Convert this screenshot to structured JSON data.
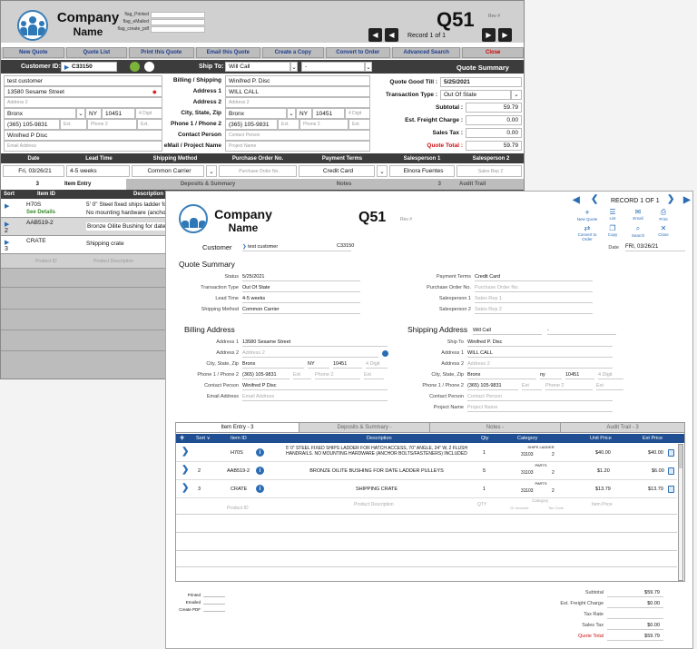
{
  "back": {
    "company": {
      "line1": "Company",
      "line2": "Name"
    },
    "flags": [
      "flag_Printed",
      "flag_eMailed",
      "flag_create_pdf"
    ],
    "quote_no": "Q51",
    "rev": "Rev #",
    "record": "Record  1  of  1",
    "toolbar": [
      "New Quote",
      "Quote List",
      "Print this Quote",
      "Email this Quote",
      "Create a Copy",
      "Convert to Order",
      "Advanced Search",
      "Close"
    ],
    "customer_id_label": "Customer ID:",
    "customer_id": "C33150",
    "ship_to_label": "Ship To:",
    "ship_to": "Will Call",
    "ship_to2": "-",
    "quote_summary_title": "Quote Summary",
    "cust": {
      "name": "test customer",
      "address1": "13580 Sesame Street",
      "address2_ph": "Address 2",
      "city": "Bronx",
      "state": "NY",
      "zip": "10451",
      "zip4_ph": "4 Digit",
      "phone": "(365) 105-9831",
      "ext_ph": "Ext.",
      "phone2_ph": "Phone 2",
      "ext2_ph": "Ext.",
      "contact": "Winifred P Disc",
      "email_ph": "Email Address"
    },
    "mid_labels": [
      "Billing / Shipping",
      "Address 1",
      "Address 2",
      "City, State, Zip",
      "Phone 1 / Phone 2",
      "Contact Person",
      "eMail / Project Name"
    ],
    "ship": {
      "name": "Winifred P. Disc",
      "address1": "WILL CALL",
      "address2_ph": "Address 2",
      "city": "Bronx",
      "state": "NY",
      "zip": "10451",
      "zip4_ph": "4 Digit",
      "phone": "(365) 105-9831",
      "ext_ph": "Ext.",
      "phone2_ph": "Phone 2",
      "ext2_ph": "Ext.",
      "contact_ph": "Contact Person",
      "project_ph": "Project Name"
    },
    "summary": {
      "good_till_label": "Quote Good Till :",
      "good_till": "5/25/2021",
      "trans_type_label": "Transaction Type :",
      "trans_type": "Out Of State",
      "subtotal_label": "Subtotal :",
      "subtotal": "59.79",
      "freight_label": "Est. Freight Charge :",
      "freight": "0.00",
      "tax_label": "Sales Tax :",
      "tax": "0.00",
      "total_label": "Quote Total :",
      "total": "59.79"
    },
    "info_headers": [
      "Date",
      "Lead Time",
      "Shipping Method",
      "Purchase Order No.",
      "Payment Terms",
      "Salesperson 1",
      "Salesperson 2"
    ],
    "info_values": {
      "date": "Fri, 03/26/21",
      "lead": "4-5 weeks",
      "ship_method": "Common Carrier",
      "po_ph": "Purchase Order No.",
      "terms": "Credit Card",
      "sp1": "Elnora Fuentes",
      "sp2_ph": "Sales Rep 2"
    },
    "tabs": [
      {
        "count": "3",
        "label": "Item Entry"
      },
      {
        "count": "",
        "label": "Deposits & Summary"
      },
      {
        "count": "",
        "label": "Notes"
      },
      {
        "count": "3",
        "label": "Audit Trail"
      }
    ],
    "list_headers": {
      "sort": "Sort",
      "item": "Item ID",
      "desc": "Description"
    },
    "items": [
      {
        "sort": "",
        "id": "H70S",
        "extra": "See Details",
        "desc": "5' 0\" Steel fixed ships ladder fo",
        "desc2": "No mounting hardware (anchor"
      },
      {
        "sort": "2",
        "id": "AAB519-2",
        "extra": "",
        "desc": "Bronze Oilite Bushing for date",
        "desc2": ""
      },
      {
        "sort": "3",
        "id": "CRATE",
        "extra": "",
        "desc": "Shipping crate",
        "desc2": ""
      }
    ],
    "new_row": {
      "product_ph": "Product ID",
      "desc_ph": "Product Description"
    }
  },
  "front": {
    "company": {
      "line1": "Company",
      "line2": "Name"
    },
    "quote_no": "Q51",
    "rev": "Rev #",
    "record": "RECORD  1  OF  1",
    "tools_row1": [
      "New Quote",
      "List",
      "Email",
      "Print"
    ],
    "tools_row2": [
      "Convert to Order",
      "Copy",
      "Search",
      "Close"
    ],
    "customer_label": "Customer",
    "customer_name": "test customer",
    "customer_id": "C33150",
    "date_label": "Date",
    "date": "FRI, 03/26/21",
    "quote_summary_title": "Quote Summary",
    "qs_left": [
      {
        "label": "Status",
        "value": "5/25/2021",
        "ph": false
      },
      {
        "label": "Transaction Type",
        "value": "Out Of State",
        "ph": false
      },
      {
        "label": "Lead Time",
        "value": "4-5 weeks",
        "ph": false
      },
      {
        "label": "Shipping Method",
        "value": "Common Carrier",
        "ph": false
      }
    ],
    "qs_right": [
      {
        "label": "Payment Terms",
        "value": "Credit Card",
        "ph": false
      },
      {
        "label": "Purchase Order No.",
        "value": "Purchase Order No.",
        "ph": true
      },
      {
        "label": "Salesperson 1",
        "value": "Sales Rep 1",
        "ph": true
      },
      {
        "label": "Salesperson 2",
        "value": "Sales Rep 2",
        "ph": true
      }
    ],
    "billing_title": "Billing Address",
    "billing": {
      "address1_label": "Address 1",
      "address1": "13580 Sesame Street",
      "address2_label": "Address 2",
      "address2_ph": "Address 2",
      "csz_label": "City, State, Zip",
      "city": "Bronx",
      "state": "NY",
      "zip": "10451",
      "zip4_ph": "4 Digit",
      "phone_label": "Phone 1 / Phone 2",
      "phone": "(365) 105-9831",
      "ext_ph": "Ext",
      "phone2_ph": "Phone 2",
      "ext2_ph": "Ext",
      "contact_label": "Contact Person",
      "contact": "Winifred P Disc",
      "email_label": "Email Address",
      "email_ph": "Email Address"
    },
    "shipping_title": "Shipping Address",
    "shipping": {
      "head": "Will Call",
      "head2": "-",
      "shipto_label": "Ship To",
      "shipto": "Winifred P. Disc",
      "address1_label": "Address 1",
      "address1": "WILL CALL",
      "address2_label": "Address 2",
      "address2_ph": "Address 2",
      "csz_label": "City, State, Zip",
      "city": "Bronx",
      "state": "ny",
      "zip": "10451",
      "zip4_ph": "4 Digit",
      "phone_label": "Phone 1 / Phone 2",
      "phone": "(365) 105-9831",
      "ext_ph": "Ext",
      "phone2_ph": "Phone 2",
      "ext2_ph": "Ext",
      "contact_label": "Contact Person",
      "contact_ph": "Contact Person",
      "project_label": "Project Name",
      "project_ph": "Project Name"
    },
    "tabs": [
      "Item Entry - 3",
      "Deposits & Summary -",
      "Notes -",
      "Audit Trail - 3"
    ],
    "grid_headers": {
      "plus": "+",
      "sort": "Sort ∨",
      "item": "Item ID",
      "desc": "Description",
      "qty": "Qty",
      "cat": "Category",
      "unit": "Unit Price",
      "ext": "Ext Price"
    },
    "rows": [
      {
        "sort": "",
        "id": "H70S",
        "desc": "5' 0\" STEEL FIXED SHIPS LADDER FOR HATCH ACCESS, 70\" ANGLE, 24\" W, 2 FLUSH HANDRAILS.  NO MOUNTING HARDWARE (ANCHOR BOLTS/FASTENERS) INCLUDED",
        "qty": "1",
        "cat": "SHIPS LADDER",
        "acct": "31103",
        "code": "2",
        "unit": "$40.00",
        "ext": "$40.00"
      },
      {
        "sort": "2",
        "id": "AAB519-2",
        "desc": "BRONZE OILITE BUSHING FOR DATE LADDER PULLEYS",
        "qty": "5",
        "cat": "PARTS",
        "acct": "31103",
        "code": "2",
        "unit": "$1.20",
        "ext": "$6.00"
      },
      {
        "sort": "3",
        "id": "CRATE",
        "desc": "SHIPPING CRATE",
        "qty": "1",
        "cat": "PARTS",
        "acct": "31103",
        "code": "2",
        "unit": "$13.79",
        "ext": "$13.79"
      }
    ],
    "new_row": {
      "product_ph": "Product ID",
      "desc_ph": "Product Description",
      "qty_ph": "QTY",
      "cat_ph": "Category",
      "acct_ph": "Gl. Account",
      "code_ph": "Tax Code",
      "unit_ph": "Item Price"
    },
    "flags": [
      "Printed",
      "Emailed",
      "Create PDF"
    ],
    "totals": [
      {
        "label": "Subtotal",
        "value": "$59.79",
        "red": false
      },
      {
        "label": "Est. Freight Charge",
        "value": "$0.00",
        "red": false
      },
      {
        "label": "Tax Rate",
        "value": "",
        "red": false
      },
      {
        "label": "Sales Tax",
        "value": "$0.00",
        "red": false
      },
      {
        "label": "Quote Total",
        "value": "$59.79",
        "red": true
      }
    ]
  },
  "colors": {
    "accent": "#2a6db5",
    "dark_bar": "#3c3c3c",
    "total_red": "#cc1111",
    "toolbar_blue": "#1d3d8f"
  }
}
